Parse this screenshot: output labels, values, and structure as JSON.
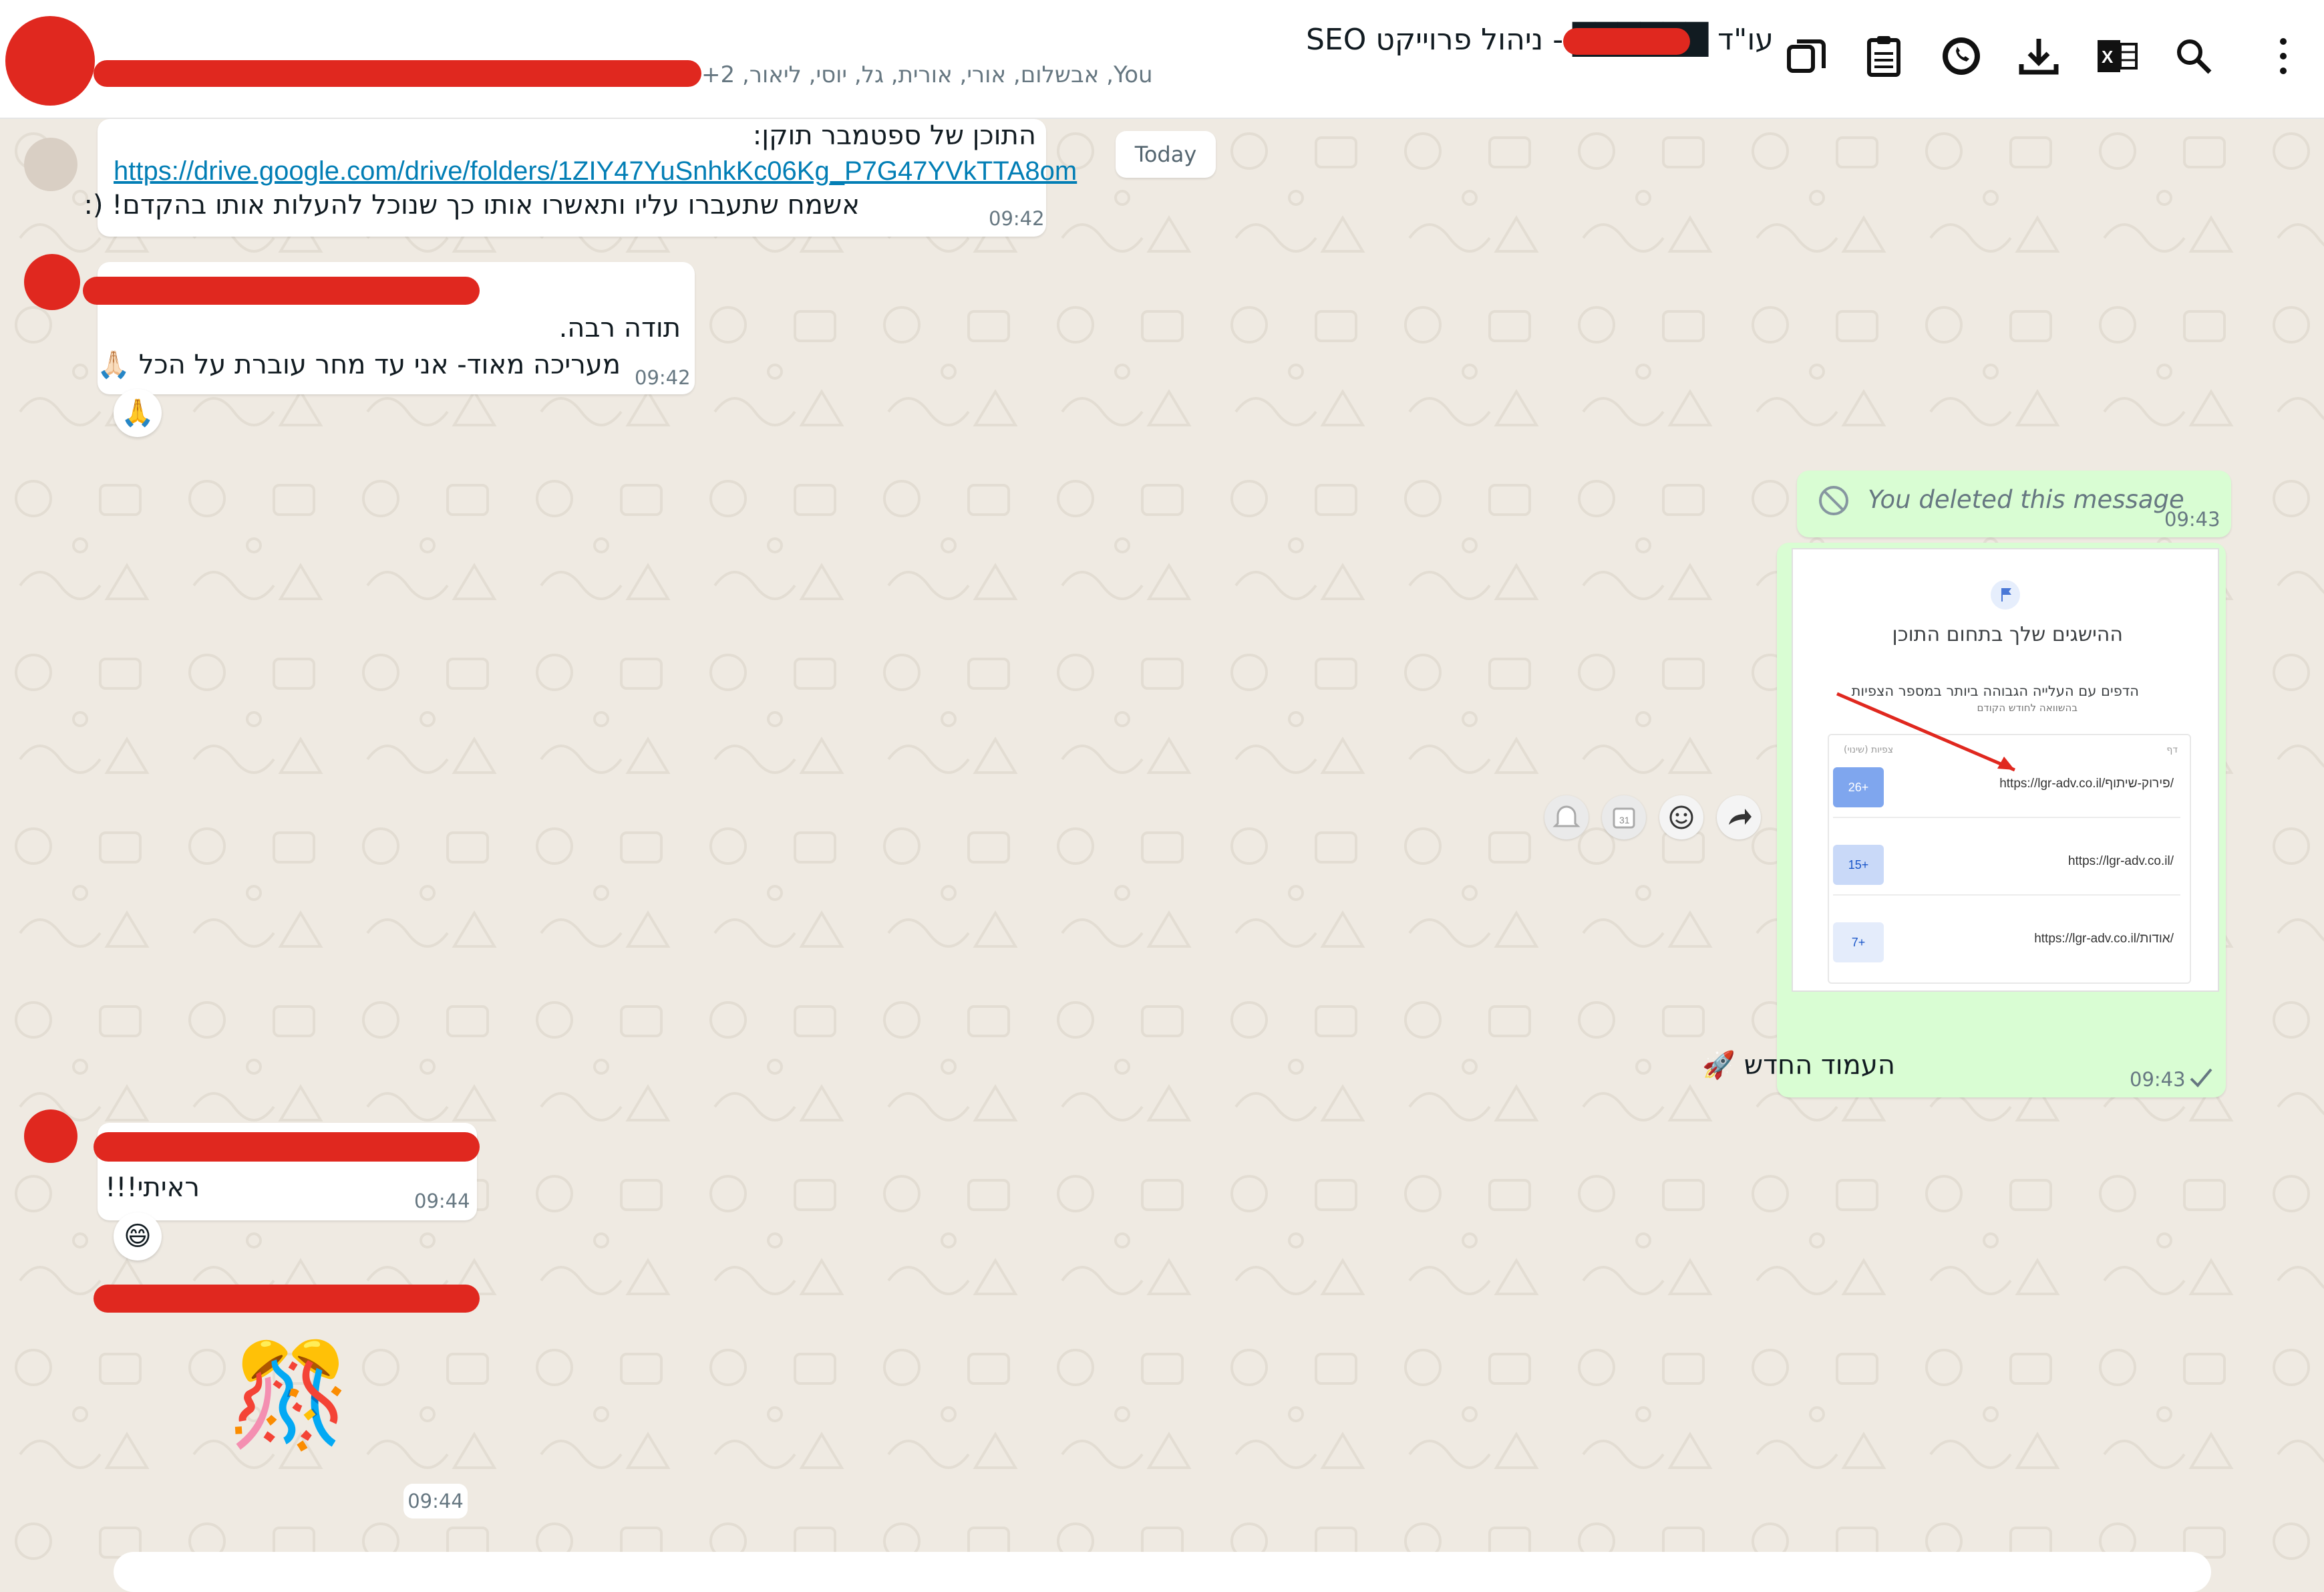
{
  "header": {
    "title": "עו\"ד ██████ - ניהול פרוייקט SEO",
    "participants": "You, אבשלום, אורי, אורית, גל, יוסי, ליאור, 2+",
    "icons": [
      "copy-icon",
      "clipboard-icon",
      "whatsapp-icon",
      "download-icon",
      "excel-icon",
      "search-icon",
      "more-icon"
    ]
  },
  "chat": {
    "date_chip": "Today",
    "messages": [
      {
        "line1": "התוכן של ספטמבר תוקן:",
        "link": "https://drive.google.com/drive/folders/1ZIY47YuSnhkKc06Kg_P7G47YVkTTA8om",
        "line3": "אשמח שתעברו עליו ותאשרו אותו כך שנוכל להעלות אותו בהקדם! (:",
        "time": "09:42"
      },
      {
        "line1": "תודה רבה.",
        "line2": "מעריכה מאוד- אני עד מחר עוברת על הכל 🙏🏻",
        "time": "09:42",
        "reaction": "🙏"
      },
      {
        "deleted_text": "You deleted this message",
        "time": "09:43"
      },
      {
        "caption": "העמוד החדש 🚀",
        "time": "09:43",
        "image": {
          "heading": "ההישגים שלך בתחום התוכן",
          "sub": "הדפים עם העלייה הגבוהה ביותר במספר הצפיות",
          "sub2": "בהשוואה לחודש הקודם",
          "col_right": "דף",
          "col_left": "צפיות (שינוי)",
          "rows": [
            {
              "badge": "26+",
              "url": "https://lgr-adv.co.il/פירוק-שיתוף/"
            },
            {
              "badge": "15+",
              "url": "https://lgr-adv.co.il/"
            },
            {
              "badge": "7+",
              "url": "https://lgr-adv.co.il/אודות/"
            }
          ]
        }
      },
      {
        "line1": "ראיתי!!!",
        "time": "09:44",
        "reaction": "😄"
      },
      {
        "sticker": "🎊",
        "time": "09:44"
      }
    ]
  },
  "colors": {
    "background": "#efeae2",
    "incoming": "#ffffff",
    "outgoing": "#d9fdd3",
    "redaction": "#e0281f",
    "link": "#027eb5"
  }
}
